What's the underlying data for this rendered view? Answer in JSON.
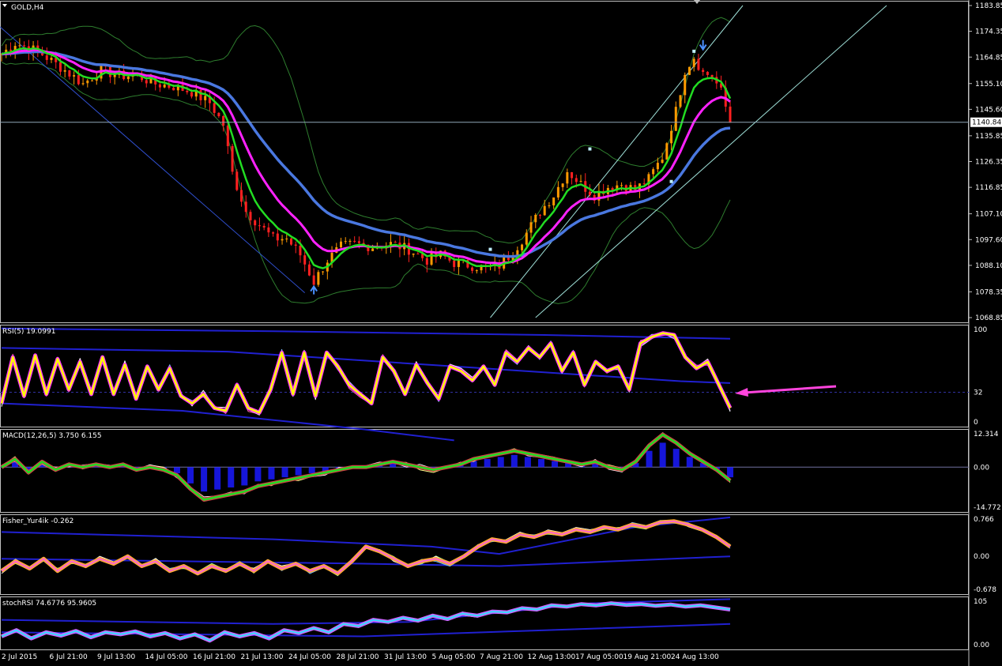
{
  "window": {
    "title": "GOLD,H4"
  },
  "colors": {
    "background": "#000000",
    "frame": "#c0c0c0",
    "bull": "#ff9a00",
    "bear": "#ff2020",
    "ema_fast": "#22dd22",
    "ema_mid": "#ff22ff",
    "ema_slow": "#4a78e0",
    "bollinger": "#2e7d2e",
    "channel": "#9fe0d8",
    "rsi": "#ffff00",
    "macd": "#22dd22",
    "hist": "#1a1aff",
    "fisher_fast": "#ff66cc",
    "fisher_slow": "#ffaa33",
    "stoch": "#33ddff",
    "arrow": "#ff44dd",
    "levels": "#2020d0"
  },
  "chart_data": [
    {
      "type": "candlestick",
      "name": "main",
      "title": "GOLD,H4",
      "ylim": [
        1068.85,
        1183.85
      ],
      "y_ticks": [
        "1183.85",
        "1174.35",
        "1164.85",
        "1155.10",
        "1145.60",
        "1135.85",
        "1126.35",
        "1116.85",
        "1107.10",
        "1097.60",
        "1088.10",
        "1078.35",
        "1068.85"
      ],
      "current_price": "1140.84",
      "x_labels": [
        "2 Jul 2015",
        "6 Jul 21:00",
        "9 Jul 13:00",
        "14 Jul 05:00",
        "16 Jul 21:00",
        "21 Jul 13:00",
        "24 Jul 05:00",
        "28 Jul 21:00",
        "31 Jul 13:00",
        "5 Aug 05:00",
        "7 Aug 21:00",
        "12 Aug 13:00",
        "17 Aug 05:00",
        "19 Aug 21:00",
        "24 Aug 13:00"
      ],
      "close_path": [
        [
          0,
          1166
        ],
        [
          3,
          1170
        ],
        [
          8,
          1167
        ],
        [
          14,
          1160
        ],
        [
          18,
          1155
        ],
        [
          22,
          1160
        ],
        [
          26,
          1158
        ],
        [
          30,
          1158
        ],
        [
          34,
          1155
        ],
        [
          38,
          1154
        ],
        [
          42,
          1152
        ],
        [
          46,
          1148
        ],
        [
          49,
          1140
        ],
        [
          51,
          1122
        ],
        [
          54,
          1108
        ],
        [
          57,
          1103
        ],
        [
          60,
          1098
        ],
        [
          63,
          1098
        ],
        [
          66,
          1092
        ],
        [
          69,
          1082
        ],
        [
          72,
          1090
        ],
        [
          75,
          1095
        ],
        [
          78,
          1096
        ],
        [
          82,
          1095
        ],
        [
          86,
          1096
        ],
        [
          90,
          1094
        ],
        [
          94,
          1090
        ],
        [
          97,
          1092
        ],
        [
          100,
          1089
        ],
        [
          104,
          1088
        ],
        [
          107,
          1087
        ],
        [
          110,
          1088
        ],
        [
          113,
          1093
        ],
        [
          116,
          1100
        ],
        [
          119,
          1108
        ],
        [
          122,
          1114
        ],
        [
          125,
          1123
        ],
        [
          128,
          1118
        ],
        [
          131,
          1114
        ],
        [
          134,
          1117
        ],
        [
          137,
          1118
        ],
        [
          140,
          1116
        ],
        [
          143,
          1120
        ],
        [
          146,
          1128
        ],
        [
          149,
          1145
        ],
        [
          151,
          1160
        ],
        [
          153,
          1165
        ],
        [
          155,
          1159
        ],
        [
          157,
          1158
        ],
        [
          159,
          1152
        ],
        [
          161,
          1141
        ]
      ],
      "overlays": [
        "EMA fast",
        "EMA mid",
        "EMA slow",
        "Bollinger bands",
        "Regression channel"
      ]
    },
    {
      "type": "line",
      "name": "rsi",
      "title": "RSI(5) 19.0991",
      "ylim": [
        0,
        100
      ],
      "y_ticks": [
        "100",
        "32",
        "0"
      ],
      "level": 32,
      "series": [
        {
          "values": [
            20,
            70,
            28,
            72,
            30,
            68,
            35,
            65,
            30,
            70,
            30,
            62,
            25,
            60,
            35,
            58,
            28,
            20,
            30,
            15,
            12,
            40,
            15,
            10,
            35,
            75,
            30,
            75,
            28,
            75,
            60,
            40,
            30,
            20,
            70,
            55,
            30,
            62,
            42,
            25,
            60,
            55,
            45,
            60,
            40,
            75,
            65,
            80,
            70,
            85,
            55,
            75,
            40,
            65,
            55,
            60,
            35,
            85,
            92,
            96,
            94,
            70,
            58,
            65,
            40,
            15
          ]
        }
      ]
    },
    {
      "type": "line",
      "name": "macd",
      "title": "MACD(12,26,5) 3.750 6.155",
      "ylim": [
        -14.772,
        12.314
      ],
      "y_ticks": [
        "12.314",
        "0.00",
        "-14.772"
      ],
      "series": [
        {
          "values": [
            0,
            3,
            -2,
            2,
            -1,
            1,
            0,
            1,
            0,
            1,
            -1,
            0,
            -1,
            -3,
            -8,
            -12,
            -11,
            -10,
            -9,
            -7,
            -6,
            -5,
            -4,
            -3,
            -2,
            -1,
            0,
            0,
            1,
            2,
            1,
            0,
            -1,
            0,
            1,
            3,
            4,
            5,
            6,
            5,
            4,
            3,
            2,
            1,
            2,
            0,
            -1,
            2,
            8,
            12,
            9,
            5,
            2,
            -1,
            -5
          ]
        }
      ]
    },
    {
      "type": "line",
      "name": "fisher",
      "title": "Fisher_Yur4ik -0.262",
      "ylim": [
        -0.678,
        0.766
      ],
      "y_ticks": [
        "0.766",
        "0.00",
        "-0.678"
      ],
      "series": [
        {
          "values": [
            -0.3,
            -0.1,
            -0.25,
            -0.05,
            -0.3,
            -0.1,
            -0.2,
            -0.05,
            -0.15,
            0.0,
            -0.2,
            -0.1,
            -0.3,
            -0.2,
            -0.35,
            -0.2,
            -0.3,
            -0.15,
            -0.3,
            -0.1,
            -0.25,
            -0.15,
            -0.3,
            -0.2,
            -0.35,
            -0.1,
            0.2,
            0.1,
            -0.05,
            -0.2,
            -0.1,
            -0.05,
            -0.15,
            0.0,
            0.2,
            0.35,
            0.3,
            0.45,
            0.4,
            0.5,
            0.45,
            0.55,
            0.5,
            0.6,
            0.55,
            0.65,
            0.6,
            0.7,
            0.72,
            0.65,
            0.55,
            0.4,
            0.2
          ]
        }
      ]
    },
    {
      "type": "line",
      "name": "stochrsi",
      "title": "stochRSI 74.6776 95.9605",
      "ylim": [
        0,
        105
      ],
      "y_ticks": [
        "105",
        "0.00"
      ],
      "series": [
        {
          "values": [
            20,
            35,
            15,
            30,
            22,
            33,
            18,
            30,
            25,
            32,
            20,
            28,
            15,
            25,
            10,
            30,
            20,
            28,
            15,
            35,
            28,
            40,
            30,
            50,
            45,
            60,
            55,
            65,
            58,
            70,
            62,
            75,
            70,
            80,
            78,
            88,
            85,
            95,
            92,
            98,
            95,
            100,
            96,
            98,
            94,
            97,
            92,
            95,
            90,
            85
          ]
        }
      ]
    }
  ]
}
